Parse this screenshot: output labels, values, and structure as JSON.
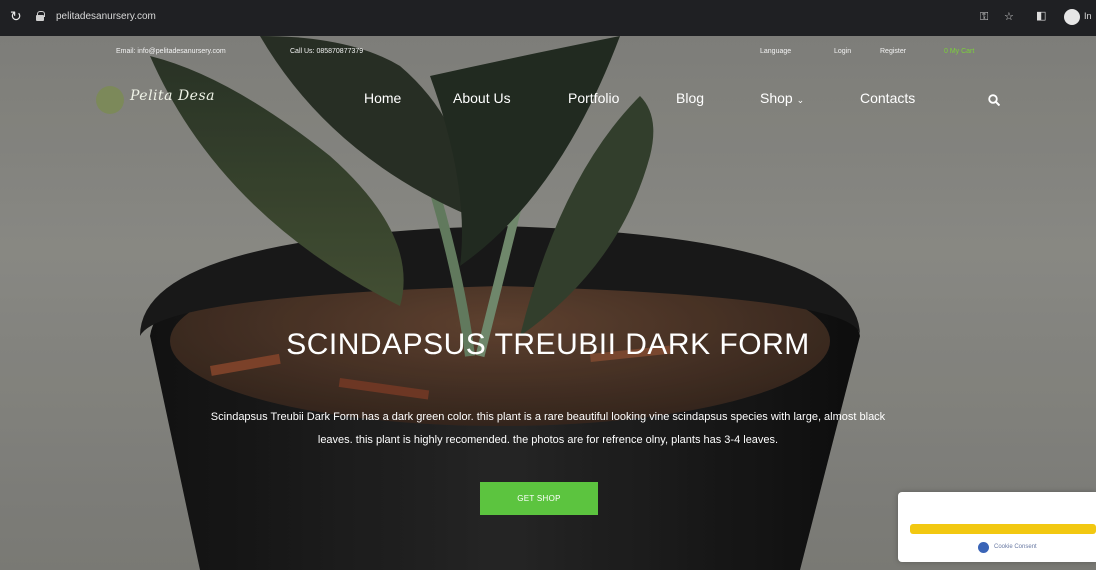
{
  "browser": {
    "url": "pelitadesanursery.com",
    "profile_label": "In"
  },
  "topbar": {
    "email": "Email: info@pelitadesanursery.com",
    "phone": "Call Us: 085870877379",
    "language": "Language",
    "login": "Login",
    "register": "Register",
    "cart": "0 My Cart"
  },
  "logo": {
    "text": "Pelita Desa"
  },
  "nav": {
    "items": [
      "Home",
      "About Us",
      "Portfolio",
      "Blog",
      "Shop",
      "Contacts"
    ]
  },
  "hero": {
    "headline": "SCINDAPSUS TREUBII DARK FORM",
    "description_line1": "Scindapsus Treubii Dark Form has a dark green color. this plant is a rare beautiful looking vine scindapsus species with large, almost black",
    "description_line2": "leaves. this plant is highly recomended. the photos are for refrence olny, plants has 3-4 leaves.",
    "cta": "GET SHOP"
  },
  "cookie_widget": {
    "label": "Cookie Consent"
  },
  "colors": {
    "accent": "#5cc43f",
    "cookie_bar": "#f2c811"
  }
}
